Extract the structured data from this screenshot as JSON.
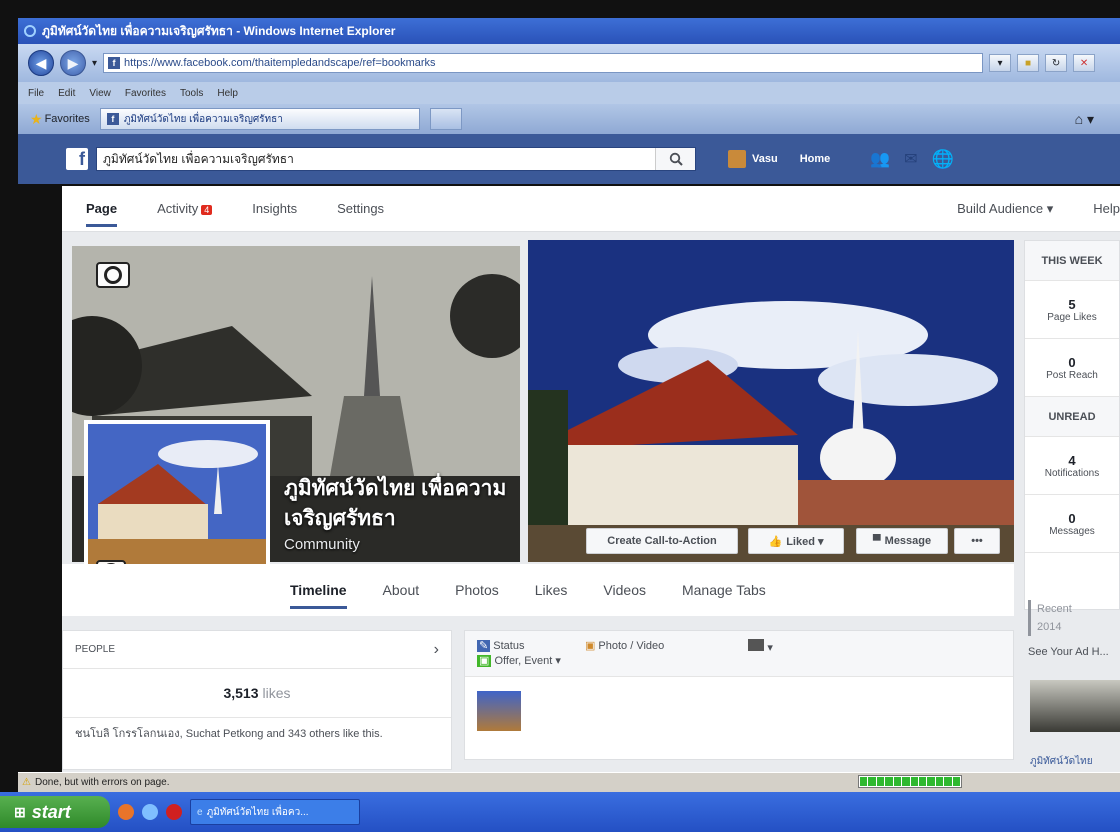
{
  "window": {
    "title": "ภูมิทัศน์วัดไทย เพื่อความเจริญศรัทธา - Windows Internet Explorer"
  },
  "browser": {
    "url": "https://www.facebook.com/thaitempledandscape/ref=bookmarks",
    "menu": [
      "File",
      "Edit",
      "View",
      "Favorites",
      "Tools",
      "Help"
    ],
    "favorites_label": "Favorites",
    "tab_title": "ภูมิทัศน์วัดไทย เพื่อความเจริญศรัทธา"
  },
  "fb": {
    "search_value": "ภูมิทัศน์วัดไทย เพื่อความเจริญศรัทธา",
    "user": "Vasu",
    "home": "Home"
  },
  "pagenav": {
    "tabs": [
      "Page",
      "Activity",
      "Insights",
      "Settings"
    ],
    "activity_badge": "4",
    "build_audience": "Build Audience ▾",
    "help": "Help"
  },
  "page": {
    "name": "ภูมิทัศน์วัดไทย เพื่อความเจริญศรัทธา",
    "category": "Community",
    "cta": "Create Call-to-Action",
    "liked": "Liked ▾",
    "message": "Message",
    "more": "•••"
  },
  "timeline_tabs": [
    "Timeline",
    "About",
    "Photos",
    "Likes",
    "Videos",
    "Manage Tabs"
  ],
  "people": {
    "heading": "PEOPLE",
    "likes_count": "3,513",
    "likes_word": "likes",
    "friends_text": "ชนโบลิ โกรรโลกนเอง, Suchat Petkong and 343 others like this."
  },
  "composer": {
    "status": "Status",
    "photo_video": "Photo / Video",
    "offer_event": "Offer, Event ▾"
  },
  "sidebar": {
    "this_week": "THIS WEEK",
    "page_likes_value": "5",
    "page_likes_label": "Page Likes",
    "post_reach_value": "0",
    "post_reach_label": "Post Reach",
    "unread": "UNREAD",
    "notifications_value": "4",
    "notifications_label": "Notifications",
    "messages_value": "0",
    "messages_label": "Messages",
    "recent": "Recent",
    "year": "2014",
    "see_ad": "See Your Ad H...",
    "ad_caption": "ภูมิทัศน์วัดไทย"
  },
  "status": {
    "text": "Done, but with errors on page.",
    "progress": 1.0
  },
  "taskbar": {
    "start": "start",
    "item": "ภูมิทัศน์วัดไทย เพื่อคว..."
  }
}
